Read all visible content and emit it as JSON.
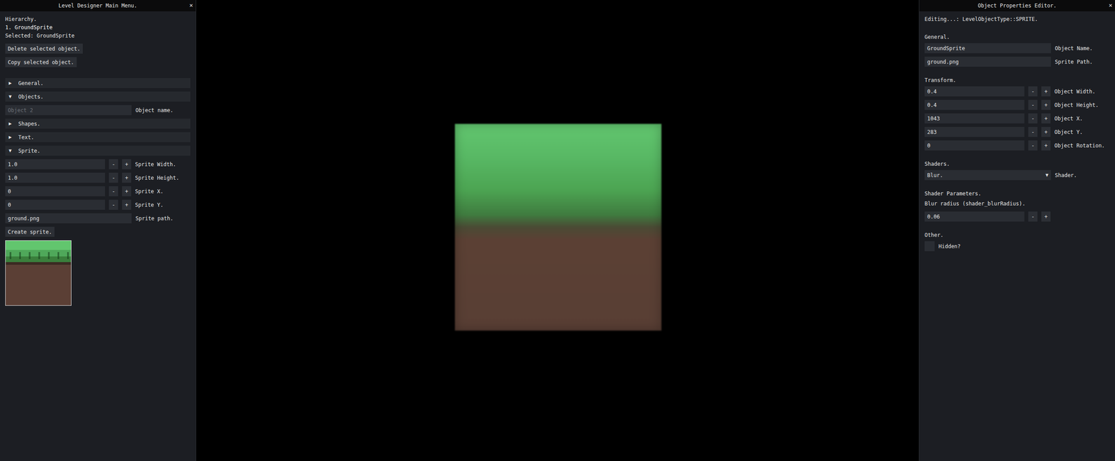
{
  "left_panel": {
    "title": "Level Designer Main Menu.",
    "close": "×",
    "hierarchy_title": "Hierarchy.",
    "hierarchy": [
      {
        "label": "1. GroundSprite",
        "selected": true
      }
    ],
    "selected_label": "Selected: GroundSprite",
    "buttons": [
      "Delete selected object.",
      "Copy selected object."
    ],
    "sections": [
      {
        "label": "General.",
        "arrow": "▶",
        "expanded": false,
        "fields": []
      },
      {
        "label": "Objects.",
        "arrow": "▼",
        "expanded": true,
        "fields": [
          {
            "kind": "text",
            "value": "",
            "placeholder": "Object 2",
            "label": "Object name."
          }
        ]
      },
      {
        "label": "Shapes.",
        "arrow": "▶",
        "expanded": false,
        "fields": []
      },
      {
        "label": "Text.",
        "arrow": "▶",
        "expanded": false,
        "fields": []
      },
      {
        "label": "Sprite.",
        "arrow": "▼",
        "expanded": true,
        "fields": [
          {
            "kind": "stepper",
            "value": "1.0",
            "label": "Sprite Width."
          },
          {
            "kind": "stepper",
            "value": "1.0",
            "label": "Sprite Height."
          },
          {
            "kind": "stepper",
            "value": "0",
            "label": "Sprite X."
          },
          {
            "kind": "stepper",
            "value": "0",
            "label": "Sprite Y."
          },
          {
            "kind": "text",
            "value": "ground.png",
            "placeholder": "",
            "label": "Sprite path."
          },
          {
            "kind": "button",
            "label": "Create sprite."
          },
          {
            "kind": "preview"
          }
        ]
      }
    ]
  },
  "stepper_buttons": {
    "minus": "-",
    "plus": "+"
  },
  "right_panel": {
    "title": "Object Properties Editor.",
    "close": "×",
    "editing": "Editing...: LevelObjectType::SPRITE.",
    "groups": [
      {
        "heading": "General.",
        "fields": [
          {
            "kind": "text",
            "value": "GroundSprite",
            "placeholder": "",
            "label": "Object Name."
          },
          {
            "kind": "text",
            "value": "ground.png",
            "placeholder": "",
            "label": "Sprite Path."
          }
        ]
      },
      {
        "heading": "Transform.",
        "fields": [
          {
            "kind": "stepper",
            "value": "0.4",
            "label": "Object Width."
          },
          {
            "kind": "stepper",
            "value": "0.4",
            "label": "Object Height."
          },
          {
            "kind": "stepper",
            "value": "1043",
            "label": "Object X."
          },
          {
            "kind": "stepper",
            "value": "283",
            "label": "Object Y."
          },
          {
            "kind": "stepper",
            "value": "0",
            "label": "Object Rotation."
          }
        ]
      },
      {
        "heading": "Shaders.",
        "fields": [
          {
            "kind": "combo",
            "value": "Blur.",
            "arrow": "▼",
            "label": "Shader."
          }
        ]
      },
      {
        "heading": "Shader Parameters.",
        "fields": [
          {
            "kind": "note",
            "label": "Blur radius (shader_blurRadius)."
          },
          {
            "kind": "stepper",
            "value": "0.06",
            "label": ""
          }
        ]
      },
      {
        "heading": "Other.",
        "fields": [
          {
            "kind": "checkbox",
            "checked": false,
            "label": "Hidden?"
          }
        ]
      }
    ]
  }
}
